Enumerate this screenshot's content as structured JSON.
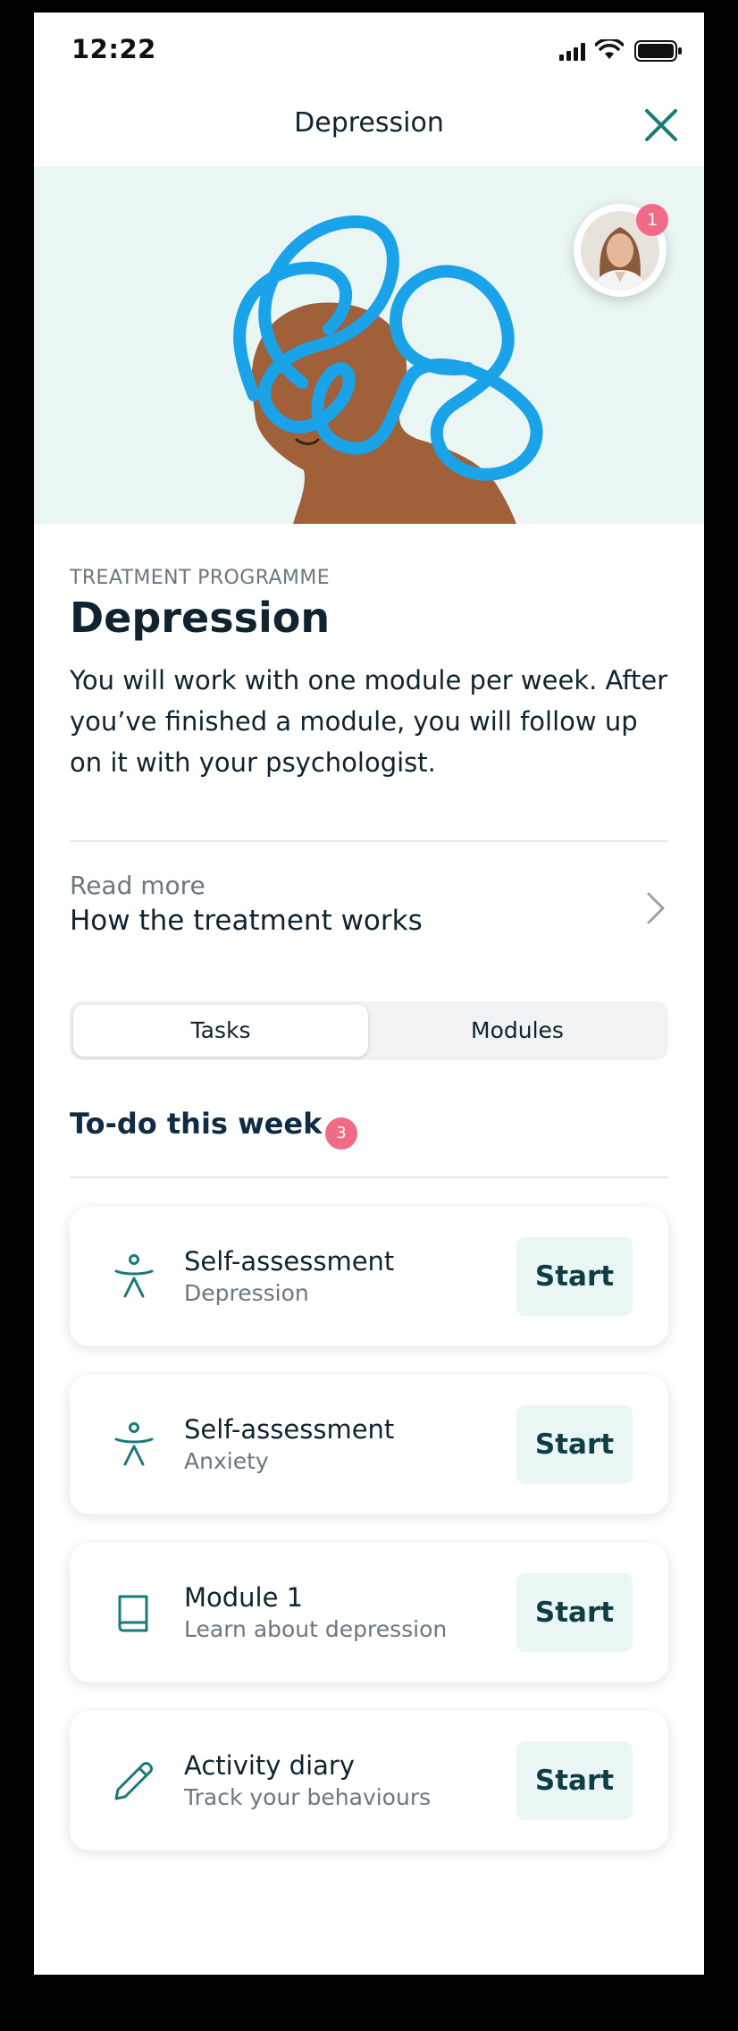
{
  "status_bar": {
    "time": "12:22"
  },
  "header": {
    "title": "Depression"
  },
  "avatar": {
    "notification_count": "1"
  },
  "intro": {
    "eyebrow": "TREATMENT PROGRAMME",
    "title": "Depression",
    "description": "You will work with one module per week. After you’ve finished a module, you will follow up on it with your psychologist."
  },
  "read_more": {
    "label": "Read more",
    "title": "How the treatment works"
  },
  "tabs": [
    {
      "label": "Tasks",
      "active": true
    },
    {
      "label": "Modules",
      "active": false
    }
  ],
  "todo": {
    "title": "To-do this week",
    "count": "3",
    "tasks": [
      {
        "icon": "person-icon",
        "title": "Self-assessment",
        "subtitle": "Depression",
        "action": "Start"
      },
      {
        "icon": "person-icon",
        "title": "Self-assessment",
        "subtitle": "Anxiety",
        "action": "Start"
      },
      {
        "icon": "book-icon",
        "title": "Module 1",
        "subtitle": "Learn about depression",
        "action": "Start"
      },
      {
        "icon": "pencil-icon",
        "title": "Activity diary",
        "subtitle": "Track your behaviours",
        "action": "Start"
      }
    ]
  },
  "colors": {
    "accent": "#1a7a78",
    "badge": "#f26b86",
    "hero_bg": "#e9f6f3",
    "scribble": "#1aa3e8",
    "skin": "#a0603a"
  }
}
